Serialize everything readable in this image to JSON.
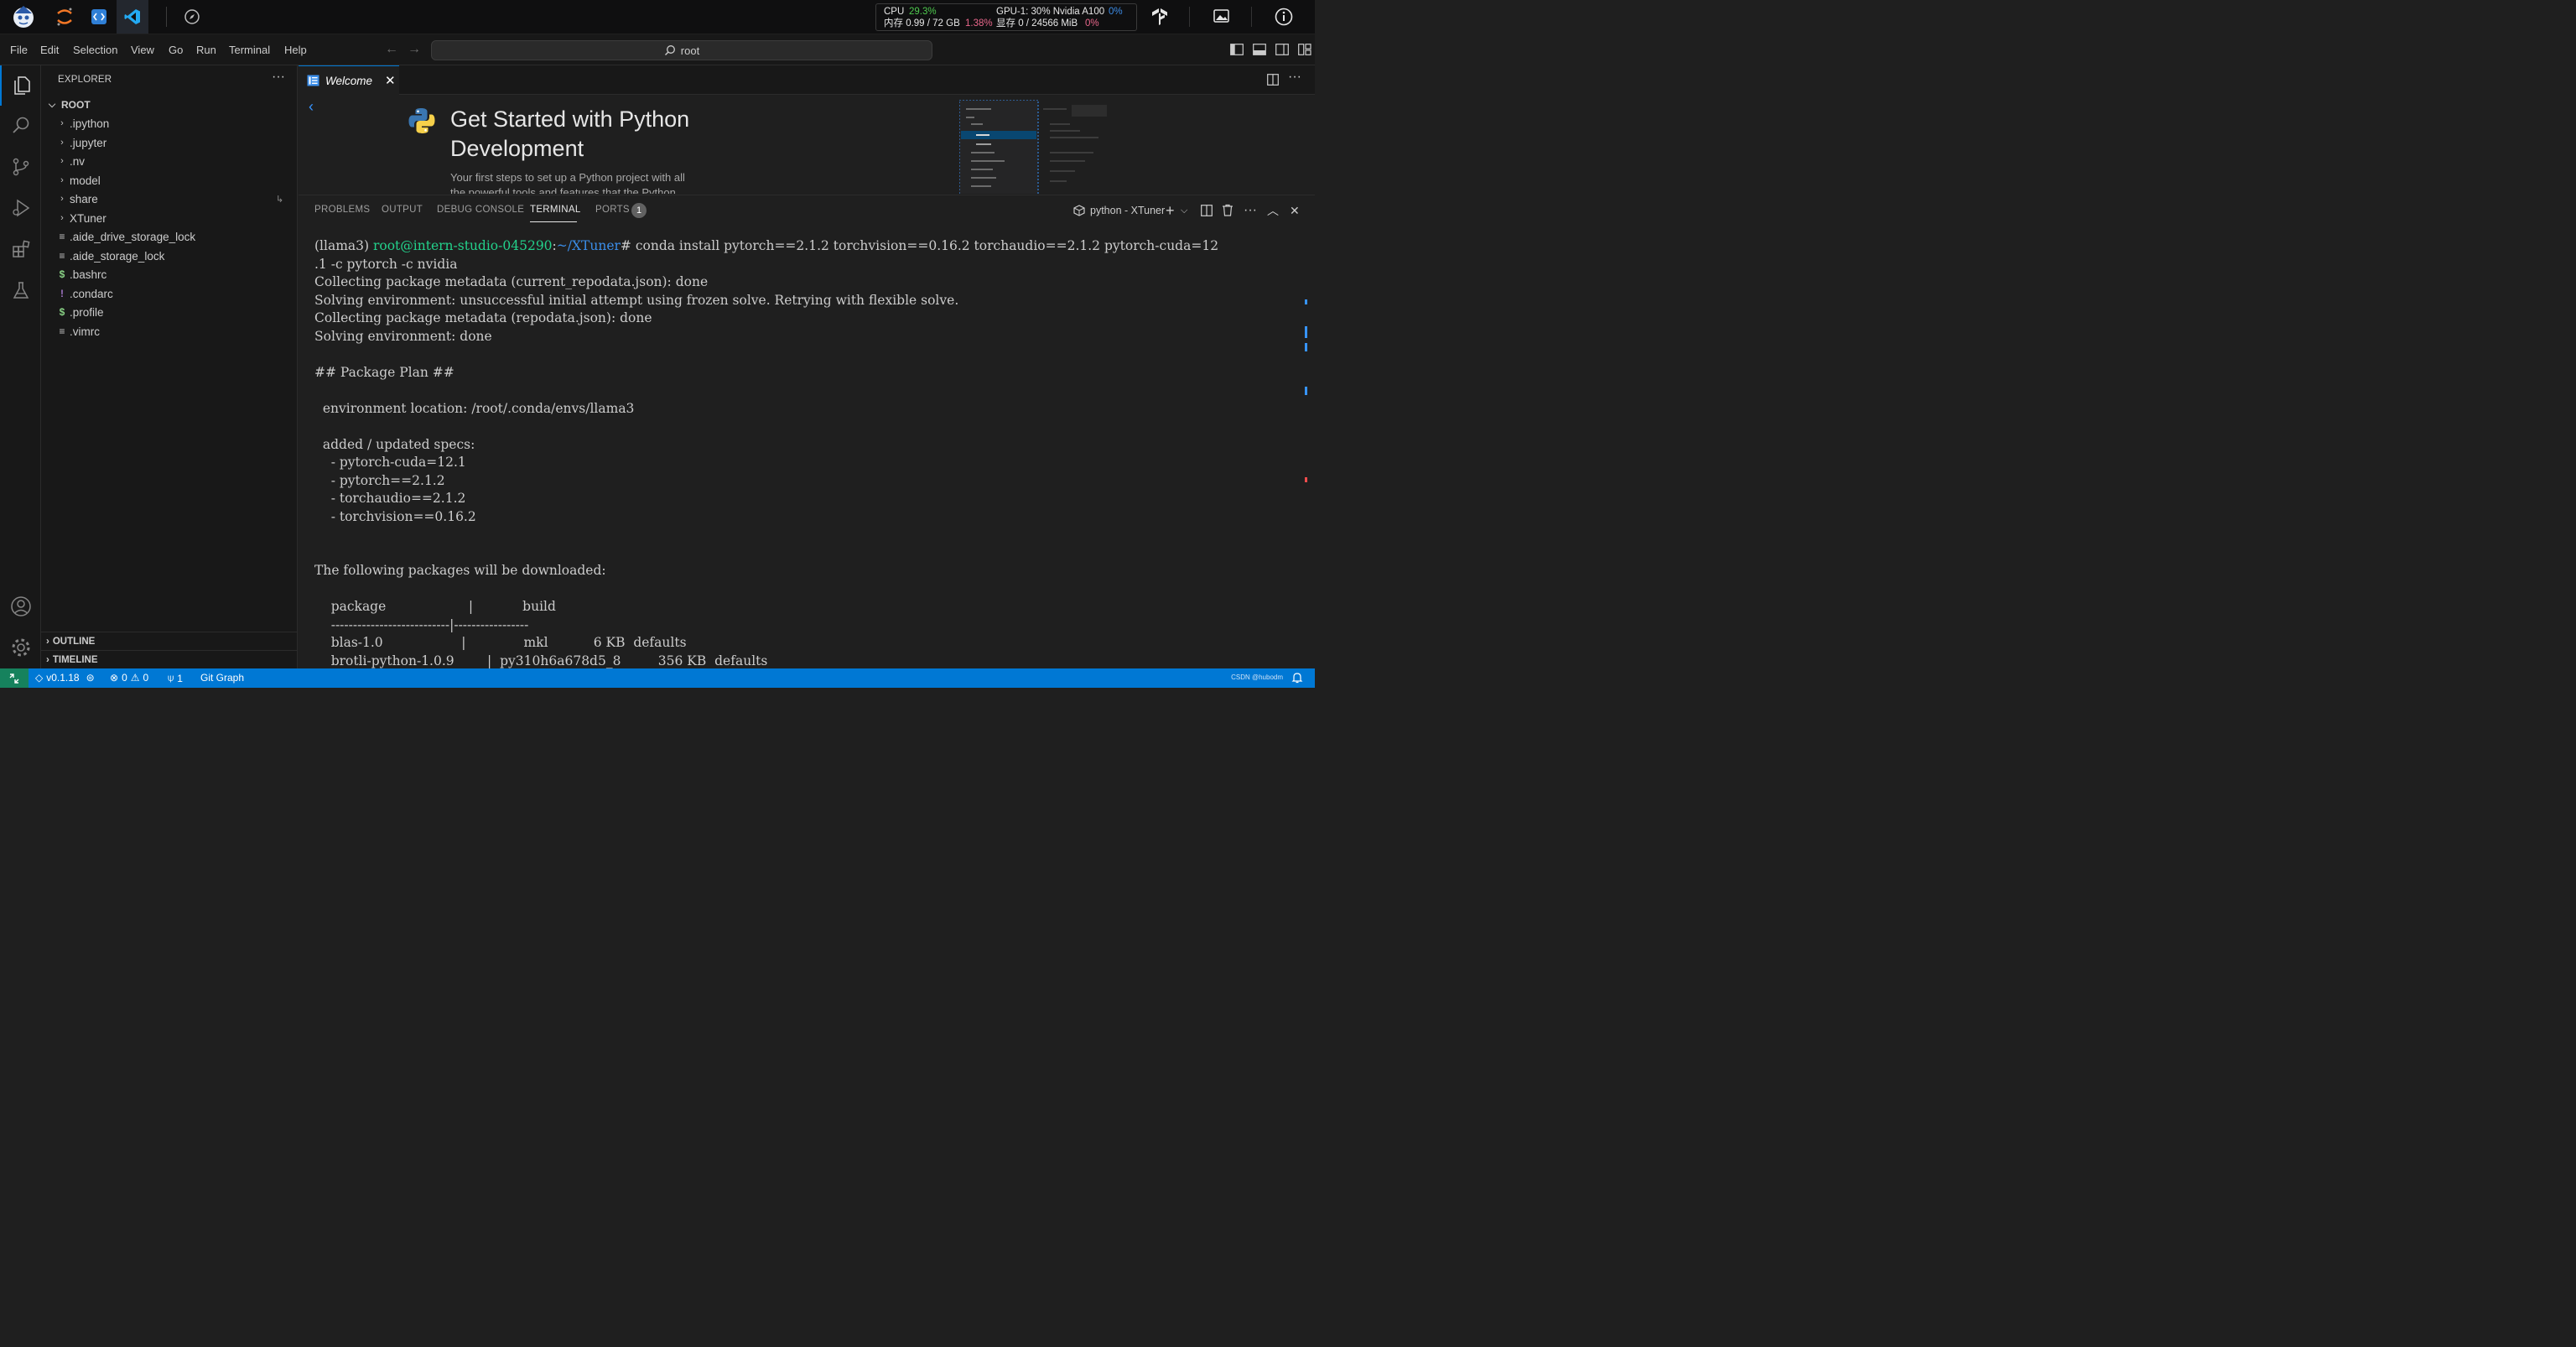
{
  "topbar": {
    "apps": [
      "intern-studio-logo",
      "jupyter-logo",
      "code-server-logo",
      "vscode-logo",
      "compass-logo"
    ],
    "stats": {
      "cpu_label": "CPU",
      "cpu_value": "29.3%",
      "mem_label": "内存 0.99 / 72 GB",
      "mem_value": "1.38%",
      "gpu_label": "GPU-1: 30% Nvidia A100",
      "gpu_value": "0%",
      "vram_label": "显存 0 / 24566 MiB",
      "vram_value": "0%"
    }
  },
  "menubar": {
    "items": [
      "File",
      "Edit",
      "Selection",
      "View",
      "Go",
      "Run",
      "Terminal",
      "Help"
    ],
    "search_text": "root"
  },
  "sidebar": {
    "title": "EXPLORER",
    "root_label": "ROOT",
    "items": [
      {
        "label": ".ipython",
        "kind": "folder"
      },
      {
        "label": ".jupyter",
        "kind": "folder"
      },
      {
        "label": ".nv",
        "kind": "folder"
      },
      {
        "label": "model",
        "kind": "folder"
      },
      {
        "label": "share",
        "kind": "folder"
      },
      {
        "label": "XTuner",
        "kind": "folder"
      },
      {
        "label": ".aide_drive_storage_lock",
        "kind": "file"
      },
      {
        "label": ".aide_storage_lock",
        "kind": "file"
      },
      {
        "label": ".bashrc",
        "kind": "shell"
      },
      {
        "label": ".condarc",
        "kind": "yaml"
      },
      {
        "label": ".profile",
        "kind": "shell"
      },
      {
        "label": ".vimrc",
        "kind": "file"
      }
    ],
    "outline_label": "OUTLINE",
    "timeline_label": "TIMELINE"
  },
  "editor": {
    "tab_label": "Welcome",
    "title": "Get Started with Python Development",
    "subtitle": "Your first steps to set up a Python project with all the powerful tools and features that the Python"
  },
  "panel": {
    "tabs": [
      "PROBLEMS",
      "OUTPUT",
      "DEBUG CONSOLE",
      "TERMINAL",
      "PORTS"
    ],
    "ports_count": "1",
    "terminal_name": "python - XTuner"
  },
  "terminal": {
    "prompt_env": "(llama3) ",
    "prompt_user": "root@intern-studio-045290",
    "prompt_colon": ":",
    "prompt_path": "~/XTuner",
    "prompt_cmd": "# conda install pytorch==2.1.2 torchvision==0.16.2 torchaudio==2.1.2 pytorch-cuda=12",
    "lines": [
      ".1 -c pytorch -c nvidia",
      "Collecting package metadata (current_repodata.json): done",
      "Solving environment: unsuccessful initial attempt using frozen solve. Retrying with flexible solve.",
      "Collecting package metadata (repodata.json): done",
      "Solving environment: done",
      "",
      "## Package Plan ##",
      "",
      "  environment location: /root/.conda/envs/llama3",
      "",
      "  added / updated specs:",
      "    - pytorch-cuda=12.1",
      "    - pytorch==2.1.2",
      "    - torchaudio==2.1.2",
      "    - torchvision==0.16.2",
      "",
      "",
      "The following packages will be downloaded:",
      "",
      "    package                    |            build",
      "    ---------------------------|-----------------",
      "    blas-1.0                   |              mkl           6 KB  defaults",
      "    brotli-python-1.0.9        |  py310h6a678d5_8         356 KB  defaults"
    ]
  },
  "statusbar": {
    "version": "v0.1.18",
    "errors": "0",
    "warnings": "0",
    "ports": "1",
    "git_graph": "Git Graph",
    "watermark": "CSDN @hubodm"
  },
  "colors": {
    "accent": "#0078d4",
    "remote": "#16825d",
    "prompt_user": "#23d18b",
    "prompt_path": "#3b8eea"
  }
}
